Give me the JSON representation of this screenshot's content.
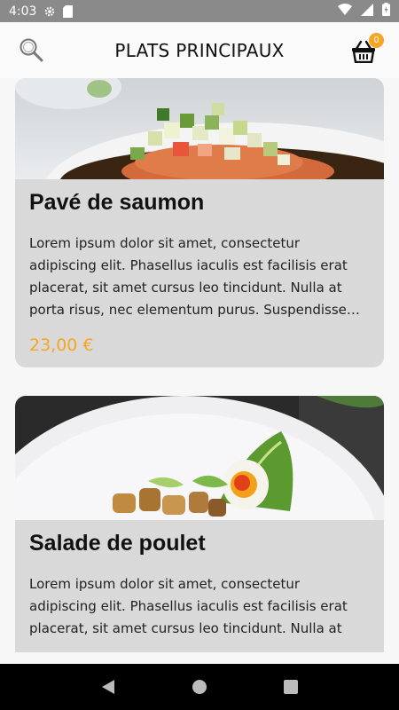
{
  "status_bar": {
    "time": "4:03",
    "icons": [
      "gear-icon",
      "sd-card-icon",
      "wifi-icon",
      "signal-icon",
      "battery-icon"
    ]
  },
  "header": {
    "title": "PLATS PRINCIPAUX",
    "cart_count": "0",
    "accent_color": "#f5a623"
  },
  "items": [
    {
      "name": "Pavé de saumon",
      "description": "Lorem ipsum dolor sit amet, consectetur adipiscing elit. Phasellus iaculis est facilisis erat placerat, sit amet cursus leo tincidunt. Nulla at porta risus, nec elementum purus. Suspendisse tincidunt",
      "price": "23,00 €"
    },
    {
      "name": "Salade de poulet",
      "description": "Lorem ipsum dolor sit amet, consectetur adipiscing elit. Phasellus iaculis est facilisis erat placerat, sit amet cursus leo tincidunt. Nulla at"
    }
  ],
  "nav_bar": {
    "buttons": [
      "back-icon",
      "home-icon",
      "recents-icon"
    ]
  }
}
